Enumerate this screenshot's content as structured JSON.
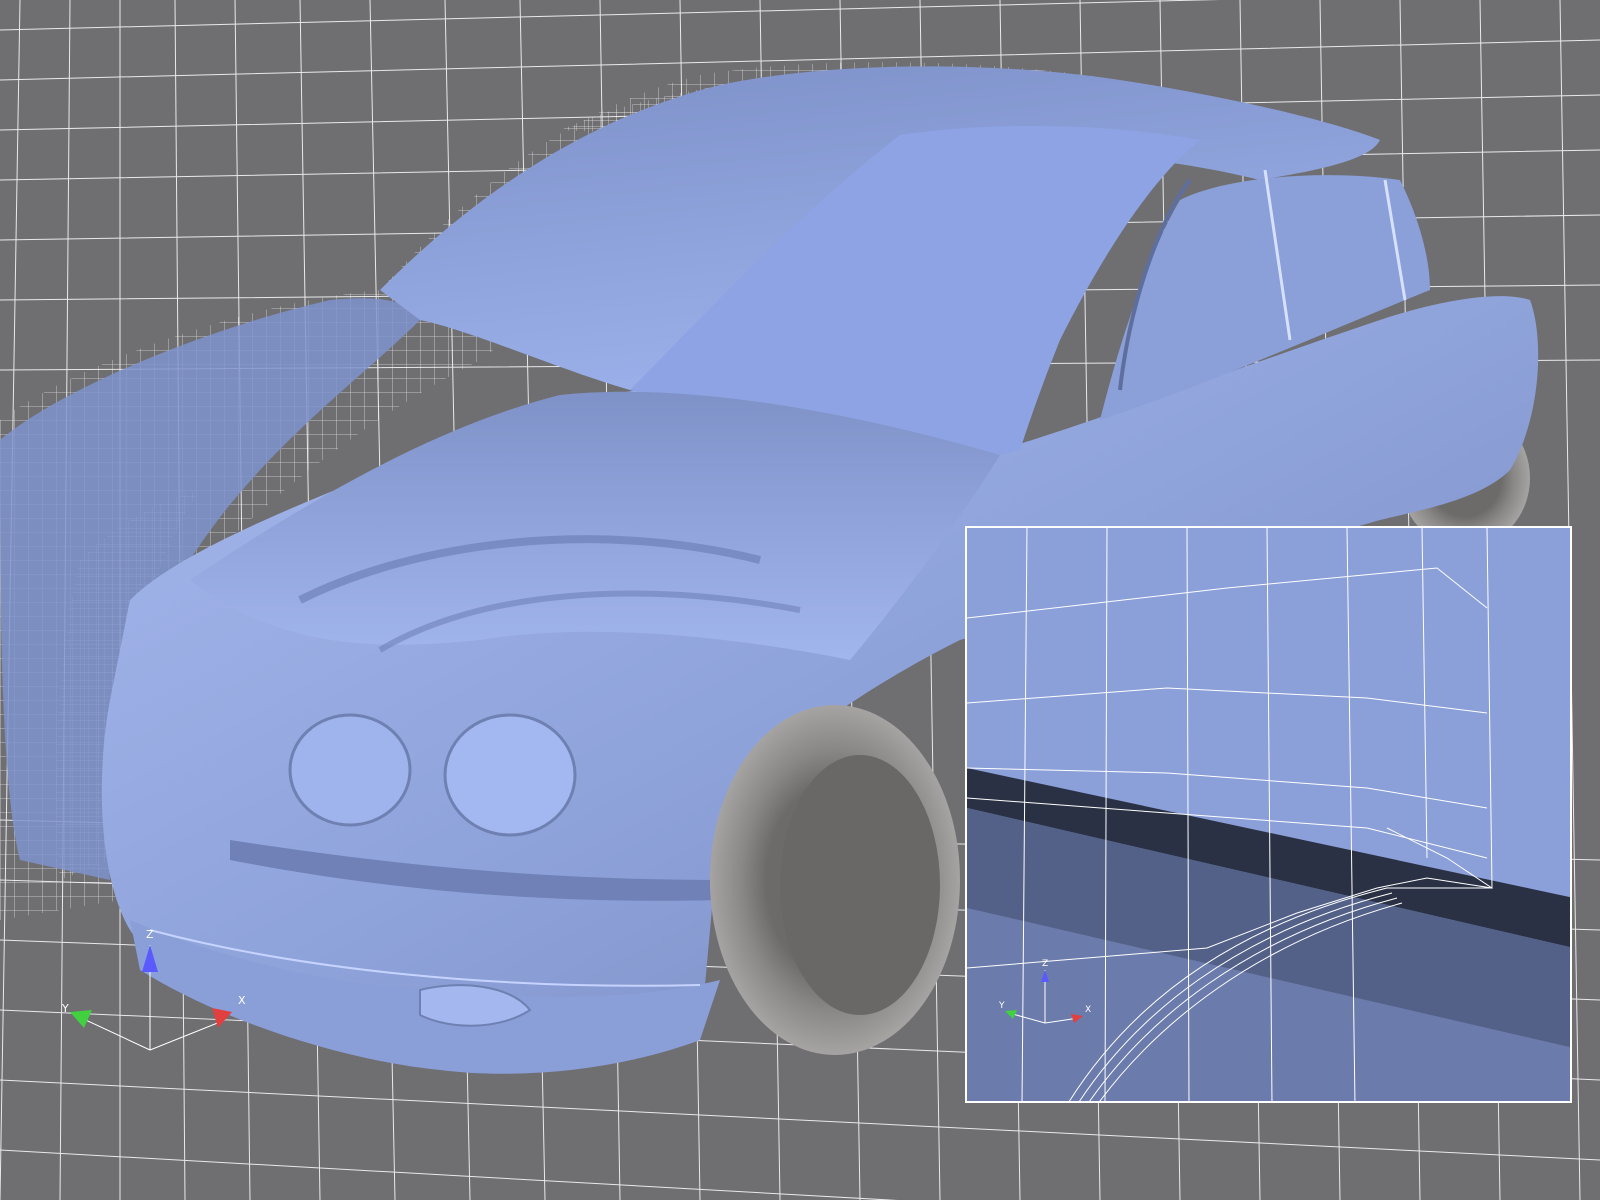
{
  "colors": {
    "background": "#6f6f72",
    "car_surface": "#8ea3da",
    "car_highlight": "#a9bdf0",
    "car_shadow": "#6877a3",
    "tire": "#8f8d8b",
    "tire_inner": "#6a6968",
    "mesh_line": "#ffffff",
    "axis_x": "#e04040",
    "axis_y": "#40d040",
    "axis_z": "#5a5aff"
  },
  "main_axes": {
    "z": "Z",
    "y": "Y",
    "x": "X"
  },
  "inset_axes": {
    "z": "Z",
    "y": "Y",
    "x": "X"
  },
  "icons": {
    "main_triad": "xyz-axis-triad-icon",
    "inset_triad": "xyz-axis-triad-icon"
  }
}
